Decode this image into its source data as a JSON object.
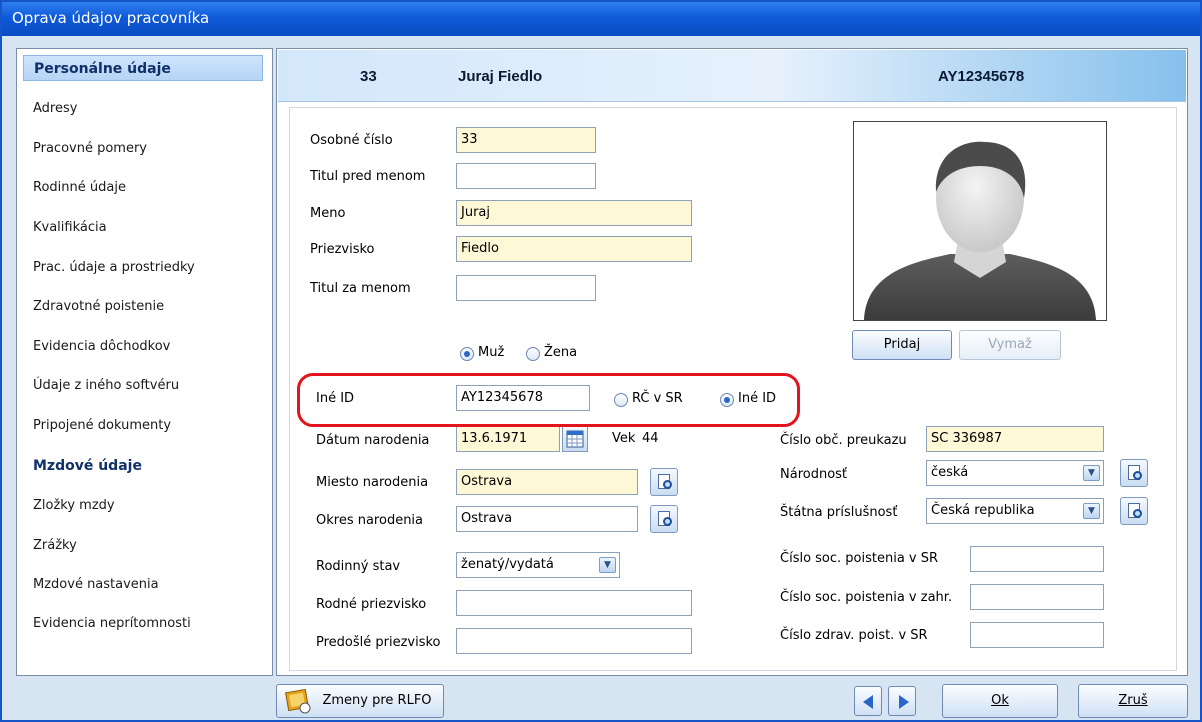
{
  "window": {
    "title": "Oprava údajov pracovníka"
  },
  "sidebar": {
    "items": [
      {
        "label": "Personálne údaje"
      },
      {
        "label": "Adresy"
      },
      {
        "label": "Pracovné pomery"
      },
      {
        "label": "Rodinné údaje"
      },
      {
        "label": "Kvalifikácia"
      },
      {
        "label": "Prac. údaje a prostriedky"
      },
      {
        "label": "Zdravotné poistenie"
      },
      {
        "label": "Evidencia dôchodkov"
      },
      {
        "label": "Údaje z iného softvéru"
      },
      {
        "label": "Pripojené dokumenty"
      },
      {
        "label": "Mzdové údaje"
      },
      {
        "label": "Zložky mzdy"
      },
      {
        "label": "Zrážky"
      },
      {
        "label": "Mzdové nastavenia"
      },
      {
        "label": "Evidencia neprítomnosti"
      }
    ]
  },
  "header": {
    "number": "33",
    "name": "Juraj Fiedlo",
    "id": "AY12345678"
  },
  "form": {
    "osobne_cislo": {
      "label": "Osobné číslo",
      "value": "33"
    },
    "titul_pred": {
      "label": "Titul pred menom",
      "value": ""
    },
    "meno": {
      "label": "Meno",
      "value": "Juraj"
    },
    "priezvisko": {
      "label": "Priezvisko",
      "value": "Fiedlo"
    },
    "titul_za": {
      "label": "Titul za menom",
      "value": ""
    },
    "gender": {
      "male": "Muž",
      "female": "Žena",
      "selected": "male"
    },
    "ine_id": {
      "label": "Iné ID",
      "value": "AY12345678",
      "opt_rc": "RČ v SR",
      "opt_ine": "Iné ID",
      "selected": "ine"
    },
    "datum_narodenia": {
      "label": "Dátum narodenia",
      "value": "13.6.1971"
    },
    "vek": {
      "label": "Vek",
      "value": "44"
    },
    "miesto_narodenia": {
      "label": "Miesto narodenia",
      "value": "Ostrava"
    },
    "okres_narodenia": {
      "label": "Okres narodenia",
      "value": "Ostrava"
    },
    "rodinny_stav": {
      "label": "Rodinný stav",
      "value": "ženatý/vydatá"
    },
    "rodne_priezvisko": {
      "label": "Rodné priezvisko",
      "value": ""
    },
    "predosle_priezvisko": {
      "label": "Predošlé priezvisko",
      "value": ""
    },
    "cislo_obc": {
      "label": "Číslo obč. preukazu",
      "value": "SC 336987"
    },
    "narodnost": {
      "label": "Národnosť",
      "value": "česká"
    },
    "statna_prislusnost": {
      "label": "Štátna príslušnosť",
      "value": "Česká republika"
    },
    "soc_sr": {
      "label": "Číslo soc. poistenia v SR",
      "value": ""
    },
    "soc_zahr": {
      "label": "Číslo soc. poistenia v zahr.",
      "value": ""
    },
    "zdrav_sr": {
      "label": "Číslo zdrav. poist. v SR",
      "value": ""
    }
  },
  "photo": {
    "add_label": "Pridaj",
    "remove_label": "Vymaž"
  },
  "footer": {
    "rlfo_label": "Zmeny pre RLFO",
    "ok_label": "Ok",
    "cancel_label": "Zruš"
  },
  "colors": {
    "title_bar": "#0f5ad8",
    "highlight": "#e3141d",
    "required_field": "#fff8d6"
  }
}
